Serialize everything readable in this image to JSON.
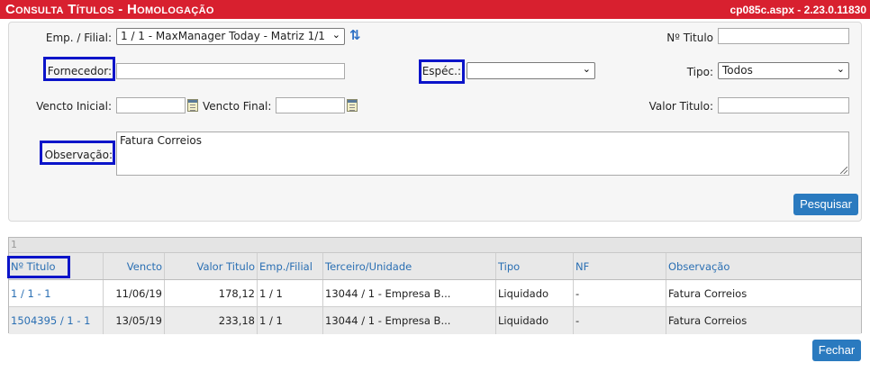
{
  "header": {
    "title": "Consulta Títulos  - Homologação",
    "version": "cp085c.aspx - 2.23.0.11830"
  },
  "filters": {
    "emp_filial_label": "Emp. / Filial:",
    "emp_filial_value": "1 / 1 - MaxManager Today - Matriz 1/1",
    "num_titulo_label": "Nº Titulo",
    "num_titulo_value": "",
    "fornecedor_label": "Fornecedor:",
    "fornecedor_value": "",
    "especie_label": "Espéc.:",
    "especie_value": "",
    "tipo_label": "Tipo:",
    "tipo_value": "Todos",
    "vencto_inicial_label": "Vencto Inicial:",
    "vencto_inicial_value": "",
    "vencto_final_label": "Vencto Final:",
    "vencto_final_value": "",
    "valor_titulo_label": "Valor Titulo:",
    "valor_titulo_value": "",
    "observacao_label": "Observação:",
    "observacao_value": "Fatura Correios",
    "search_label": "Pesquisar"
  },
  "grid": {
    "page": "1",
    "columns": [
      "Nº Titulo",
      "Vencto",
      "Valor Titulo",
      "Emp./Filial",
      "Terceiro/Unidade",
      "Tipo",
      "NF",
      "Observação"
    ],
    "rows": [
      [
        "1 / 1 - 1",
        "11/06/19",
        "178,12",
        "1 / 1",
        "13044 / 1 - Empresa B...",
        "Liquidado",
        "-",
        "Fatura Correios"
      ],
      [
        "1504395 / 1 - 1",
        "13/05/19",
        "233,18",
        "1 / 1",
        "13044 / 1 - Empresa B...",
        "Liquidado",
        "-",
        "Fatura Correios"
      ]
    ]
  },
  "footer": {
    "close_label": "Fechar"
  },
  "colors": {
    "titlebar": "#d8202f",
    "button": "#2a7abf",
    "highlight": "#0b14c9",
    "link": "#2a6fb3"
  },
  "icons": [
    "refresh-icon",
    "calendar-icon",
    "chevron-down-icon"
  ]
}
